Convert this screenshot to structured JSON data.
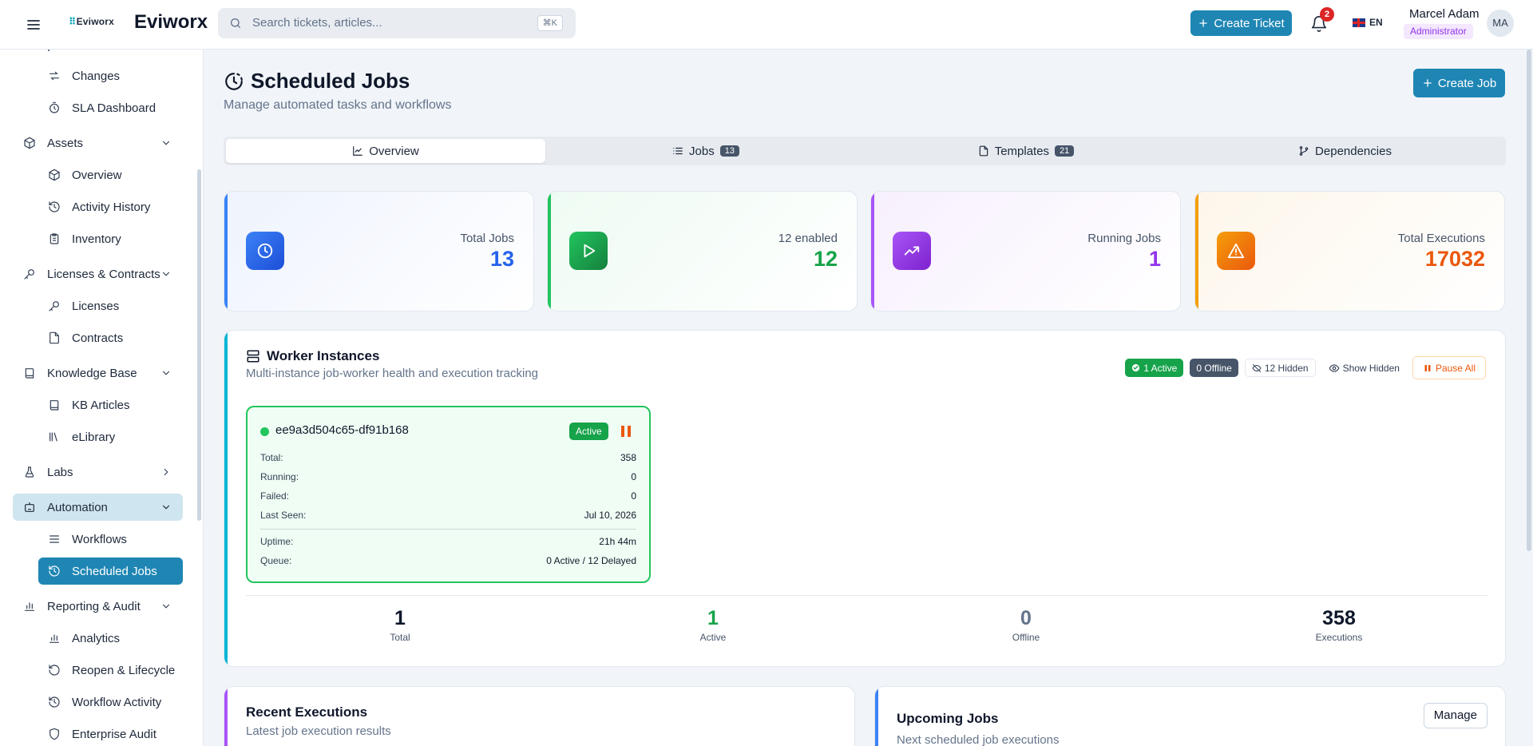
{
  "header": {
    "logo_badge": "Eviworx",
    "logo_text": "Eviworx",
    "search_placeholder": "Search tickets, articles...",
    "search_shortcut": "⌘K",
    "create_ticket_label": "Create Ticket",
    "notification_count": "2",
    "language": "EN",
    "user_name": "Marcel Adam",
    "user_role": "Administrator",
    "avatar_initials": "MA"
  },
  "sidebar": {
    "items": [
      {
        "label": "Changes",
        "icon": "changes-icon"
      },
      {
        "label": "SLA Dashboard",
        "icon": "timer-icon"
      },
      {
        "label": "Assets",
        "icon": "box-icon"
      },
      {
        "label": "Overview",
        "icon": "box-icon"
      },
      {
        "label": "Activity History",
        "icon": "history-icon"
      },
      {
        "label": "Inventory",
        "icon": "clipboard-icon"
      },
      {
        "label": "Licenses & Contracts",
        "icon": "key-icon"
      },
      {
        "label": "Licenses",
        "icon": "key-icon"
      },
      {
        "label": "Contracts",
        "icon": "file-icon"
      },
      {
        "label": "Knowledge Base",
        "icon": "book-icon"
      },
      {
        "label": "KB Articles",
        "icon": "book-icon"
      },
      {
        "label": "eLibrary",
        "icon": "library-icon"
      },
      {
        "label": "Labs",
        "icon": "flask-icon"
      },
      {
        "label": "Automation",
        "icon": "bot-icon"
      },
      {
        "label": "Workflows",
        "icon": "list-icon"
      },
      {
        "label": "Scheduled Jobs",
        "icon": "history-icon"
      },
      {
        "label": "Reporting & Audit",
        "icon": "chart-icon"
      },
      {
        "label": "Analytics",
        "icon": "chart-icon"
      },
      {
        "label": "Reopen & Lifecycle",
        "icon": "rotate-icon"
      },
      {
        "label": "Workflow Activity",
        "icon": "history-icon"
      },
      {
        "label": "Enterprise Audit",
        "icon": "shield-icon"
      }
    ]
  },
  "page": {
    "title": "Scheduled Jobs",
    "subtitle": "Manage automated tasks and workflows",
    "create_job_label": "Create Job"
  },
  "tabs": [
    {
      "label": "Overview",
      "count": null
    },
    {
      "label": "Jobs",
      "count": "13"
    },
    {
      "label": "Templates",
      "count": "21"
    },
    {
      "label": "Dependencies",
      "count": null
    }
  ],
  "stats": [
    {
      "label": "Total Jobs",
      "value": "13",
      "color": "#2563eb"
    },
    {
      "label": "12 enabled",
      "value": "12",
      "color": "#16a34a"
    },
    {
      "label": "Running Jobs",
      "value": "1",
      "color": "#9333ea"
    },
    {
      "label": "Total Executions",
      "value": "17032",
      "color": "#ea580c"
    }
  ],
  "worker": {
    "title": "Worker Instances",
    "subtitle": "Multi-instance job-worker health and execution tracking",
    "badge_active": "1 Active",
    "badge_offline": "0 Offline",
    "badge_hidden": "12 Hidden",
    "show_hidden_label": "Show Hidden",
    "pause_all_label": "Pause All",
    "instance": {
      "id": "ee9a3d504c65-df91b168",
      "status": "Active",
      "rows": [
        {
          "label": "Total:",
          "value": "358"
        },
        {
          "label": "Running:",
          "value": "0"
        },
        {
          "label": "Failed:",
          "value": "0"
        },
        {
          "label": "Last Seen:",
          "value": "Jul 10, 2026"
        },
        {
          "label": "Uptime:",
          "value": "21h 44m"
        },
        {
          "label": "Queue:",
          "value": "0 Active / 12 Delayed"
        }
      ]
    },
    "summary": [
      {
        "value": "1",
        "label": "Total",
        "color": "#0f172a"
      },
      {
        "value": "1",
        "label": "Active",
        "color": "#16a34a"
      },
      {
        "value": "0",
        "label": "Offline",
        "color": "#64748b"
      },
      {
        "value": "358",
        "label": "Executions",
        "color": "#0f172a"
      }
    ]
  },
  "recent": {
    "title": "Recent Executions",
    "subtitle": "Latest job execution results"
  },
  "upcoming": {
    "title": "Upcoming Jobs",
    "subtitle": "Next scheduled job executions",
    "manage_label": "Manage"
  }
}
